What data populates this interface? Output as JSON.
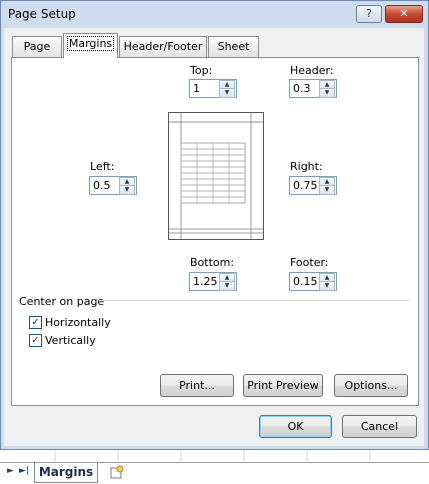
{
  "window": {
    "title": "Page Setup",
    "help_button": "?",
    "close_button": "✕"
  },
  "tabs": [
    "Page",
    "Margins",
    "Header/Footer",
    "Sheet"
  ],
  "active_tab": "Margins",
  "margins": {
    "top": {
      "label": "Top:",
      "value": "1"
    },
    "header": {
      "label": "Header:",
      "value": "0.3"
    },
    "left": {
      "label": "Left:",
      "value": "0.5"
    },
    "right": {
      "label": "Right:",
      "value": "0.75"
    },
    "bottom": {
      "label": "Bottom:",
      "value": "1.25"
    },
    "footer": {
      "label": "Footer:",
      "value": "0.15"
    }
  },
  "center_on_page": {
    "label": "Center on page",
    "horizontally": {
      "label": "Horizontally",
      "checked": true
    },
    "vertically": {
      "label": "Vertically",
      "checked": true
    }
  },
  "buttons": {
    "print": "Print...",
    "print_preview": "Print Preview",
    "options": "Options...",
    "ok": "OK",
    "cancel": "Cancel"
  },
  "sheet_bar": {
    "sheet_tab": "Margins"
  },
  "icons": {
    "spin_up": "▲",
    "spin_down": "▼",
    "check": "✓",
    "nav_next": "►",
    "nav_last": "►|"
  }
}
